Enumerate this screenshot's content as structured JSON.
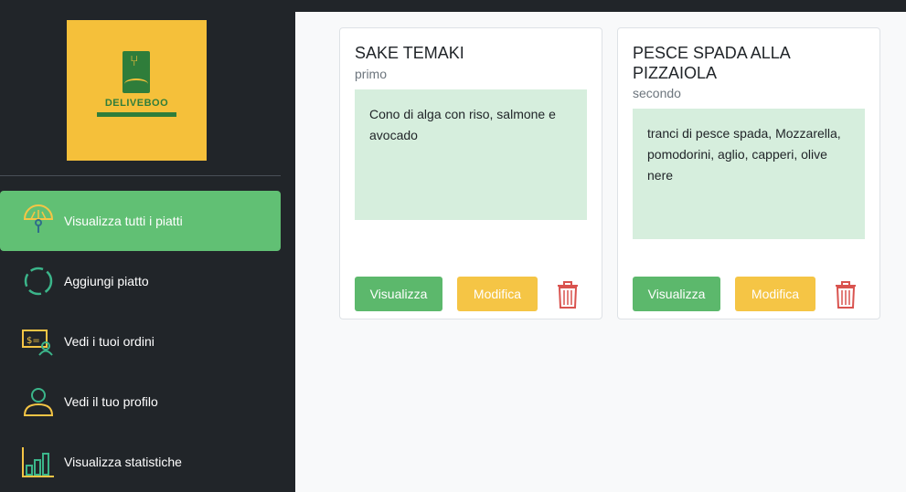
{
  "sidebar": {
    "logo": {
      "brand": "DELIVEBOO"
    },
    "items": [
      {
        "label": "Visualizza tutti i piatti",
        "icon": "menu-plate-icon",
        "active": true
      },
      {
        "label": "Aggiungi piatto",
        "icon": "circle-loading-icon",
        "active": false
      },
      {
        "label": "Vedi i tuoi ordini",
        "icon": "orders-money-icon",
        "active": false
      },
      {
        "label": "Vedi il tuo profilo",
        "icon": "user-profile-icon",
        "active": false
      },
      {
        "label": "Visualizza statistiche",
        "icon": "bar-chart-icon",
        "active": false
      }
    ]
  },
  "dishes": [
    {
      "name": "SAKE TEMAKI",
      "course": "primo",
      "description": "Cono di alga con riso, salmone e avocado",
      "view_label": "Visualizza",
      "edit_label": "Modifica"
    },
    {
      "name": "PESCE SPADA ALLA PIZZAIOLA",
      "course": "secondo",
      "description": "tranci di pesce spada, Mozzarella, pomodorini, aglio, capperi, olive nere",
      "view_label": "Visualizza",
      "edit_label": "Modifica"
    }
  ],
  "colors": {
    "sidebar_bg": "#212529",
    "active_green": "#61c074",
    "view_button": "#5cb86c",
    "edit_button": "#f5c545",
    "delete_icon": "#d9534f",
    "desc_bg": "#d6eedd",
    "logo_bg": "#f5c03a"
  }
}
